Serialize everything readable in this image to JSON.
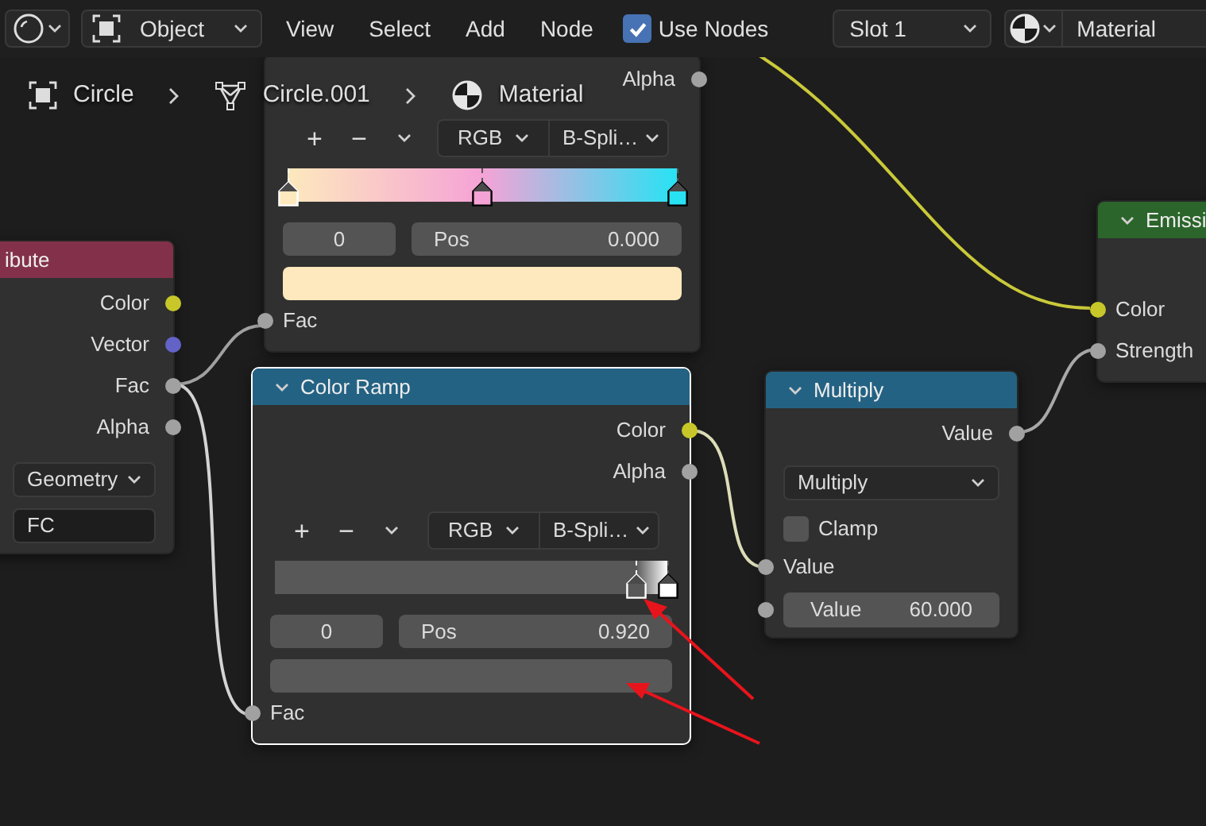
{
  "header": {
    "object_mode": "Object",
    "menus": [
      "View",
      "Select",
      "Add",
      "Node"
    ],
    "use_nodes": {
      "label": "Use Nodes",
      "checked": true
    },
    "slot": "Slot 1",
    "material": "Material"
  },
  "breadcrumbs": [
    {
      "kind": "object",
      "label": "Circle"
    },
    {
      "kind": "mesh",
      "label": "Circle.001"
    },
    {
      "kind": "material",
      "label": "Material"
    }
  ],
  "nodes": [
    {
      "selected": false,
      "rows": [
        {
          "kind": "output",
          "label": "Alpha",
          "color": "#a1a1a1"
        },
        {
          "kind": "ramp",
          "buttons": [
            "+",
            "−"
          ],
          "color_mode": "RGB",
          "interpolation": "B-Spli…",
          "stops": [
            {
              "color": "#fde9bd",
              "level": 0,
              "selected": true
            },
            {
              "color": "#f5a3d6",
              "level": 0.5,
              "selected": false
            },
            {
              "color": "#28e2f4",
              "level": 1,
              "selected": false
            }
          ],
          "index": "0",
          "pos_label": "Pos",
          "pos_value": "0.000"
        },
        {
          "kind": "input",
          "label": "Fac",
          "color": "#a1a1a1"
        }
      ]
    },
    {
      "kind": "input",
      "title": "ibute",
      "selected": false,
      "rows": [
        {
          "kind": "output",
          "label": "Color",
          "color": "#c7c729"
        },
        {
          "kind": "output",
          "label": "Vector",
          "color": "#6363c7"
        },
        {
          "kind": "output",
          "label": "Fac",
          "color": "#a1a1a1"
        },
        {
          "kind": "output",
          "label": "Alpha",
          "color": "#a1a1a1"
        },
        {
          "kind": "dropdown",
          "value": "Geometry"
        },
        {
          "kind": "text_field",
          "value": "FC"
        }
      ]
    },
    {
      "kind": "converter",
      "title": "Color Ramp",
      "selected": true,
      "rows": [
        {
          "kind": "output",
          "label": "Color",
          "color": "#c7c729"
        },
        {
          "kind": "output",
          "label": "Alpha",
          "color": "#a1a1a1"
        },
        {
          "kind": "ramp",
          "buttons": [
            "+",
            "−"
          ],
          "color_mode": "RGB",
          "interpolation": "B-Spli…",
          "stops": [
            {
              "color": "#585858",
              "level": 0.92,
              "selected": true
            },
            {
              "color": "#ffffff",
              "level": 1,
              "selected": false
            }
          ],
          "index": "0",
          "pos_label": "Pos",
          "pos_value": "0.920"
        },
        {
          "kind": "input",
          "label": "Fac",
          "color": "#a1a1a1"
        }
      ]
    },
    {
      "kind": "converter",
      "title": "Multiply",
      "selected": false,
      "rows": [
        {
          "kind": "output",
          "label": "Value",
          "color": "#a1a1a1"
        },
        {
          "kind": "dropdown",
          "value": "Multiply"
        },
        {
          "kind": "checkbox",
          "label": "Clamp",
          "checked": false
        },
        {
          "kind": "input",
          "label": "Value",
          "color": "#a1a1a1"
        },
        {
          "kind": "value_field",
          "label": "Value",
          "value": "60.000",
          "color": "#a1a1a1"
        }
      ]
    },
    {
      "kind": "shader",
      "title": "Emissi",
      "selected": false,
      "rows": [
        {
          "kind": "input",
          "label": "Color",
          "color": "#c7c729"
        },
        {
          "kind": "input",
          "label": "Strength",
          "color": "#a1a1a1"
        }
      ]
    }
  ]
}
